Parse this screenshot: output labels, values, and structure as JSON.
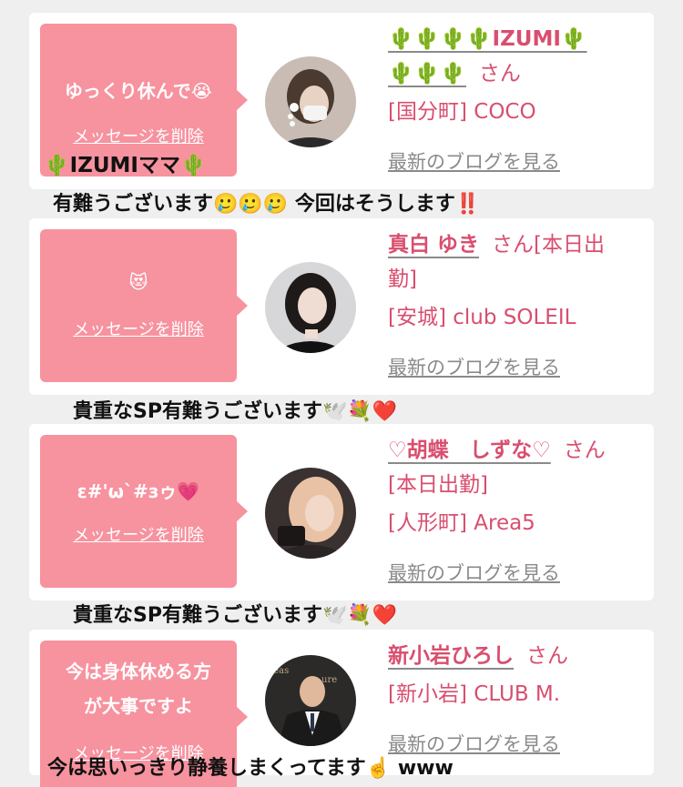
{
  "delete_label": "メッセージを削除",
  "blog_label": "最新のブログを見る",
  "colors": {
    "bubble": "#f7929f",
    "accent": "#d94e6e",
    "muted": "#8a8a8a",
    "background": "#efefef"
  },
  "entries": [
    {
      "message": "ゆっくり休んで😭",
      "sender_name": "🌵IZUMIママ🌵",
      "name": "🌵🌵🌵🌵IZUMI🌵🌵🌵🌵",
      "name_line1": "🌵🌵🌵🌵IZUMI🌵",
      "name_line2": "🌵🌵🌵",
      "suffix": "さん",
      "shop": "[国分町] COCO",
      "reply": "有難うございます🥲🥲🥲 今回はそうします‼️"
    },
    {
      "message": "😻",
      "name": "真白 ゆき",
      "suffix": "さん[本日出勤]",
      "suffix_line1": "さん[本日出",
      "suffix_line2": "勤]",
      "shop": "[安城] club SOLEIL",
      "reply": "貴重なSP有難うございます🕊️💐❤️"
    },
    {
      "message": "ε#'ω`#зゥ💗",
      "name": "♡胡蝶　しずな♡",
      "suffix": "さん",
      "status": "[本日出勤]",
      "shop": "[人形町] Area5",
      "reply": "貴重なSP有難うございます🕊️💐❤️"
    },
    {
      "message": "今は身体休める方が大事ですよ",
      "message_line1": "今は身体休める方",
      "message_line2": "が大事ですよ",
      "name": "新小岩ひろし",
      "suffix": "さん",
      "shop": "[新小岩] CLUB M.",
      "reply": "今は思いっきり静養しまくってます☝️ www"
    }
  ]
}
